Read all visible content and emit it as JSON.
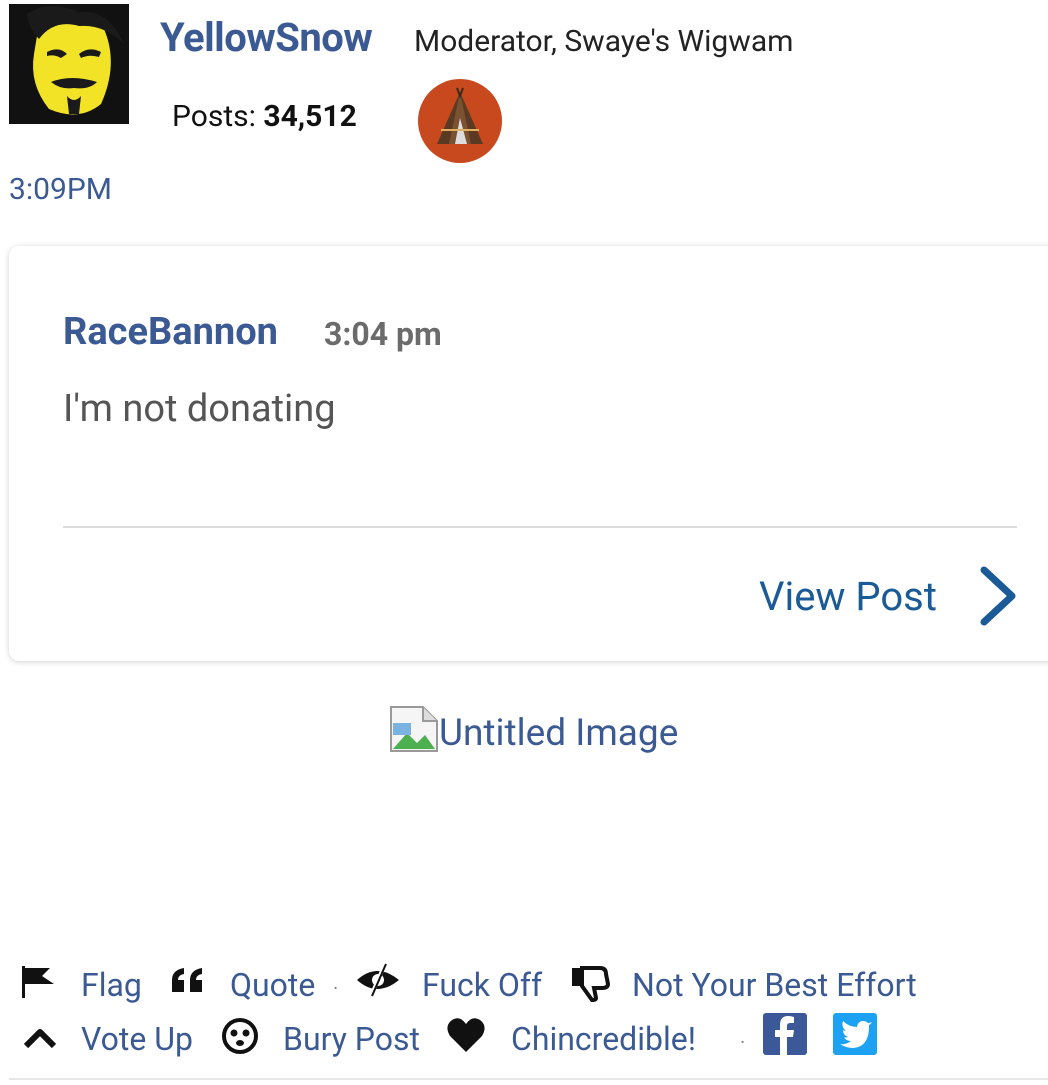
{
  "author": {
    "name": "YellowSnow",
    "role": "Moderator, Swaye's Wigwam",
    "posts_label": "Posts:",
    "posts_count": "34,512",
    "avatar": "user-avatar",
    "badge": "teepee-badge"
  },
  "post_time": "3:09PM",
  "quote": {
    "author": "RaceBannon",
    "time": "3:04 pm",
    "body": "I'm not donating",
    "view_label": "View Post"
  },
  "image": {
    "alt": "Untitled Image"
  },
  "actions": {
    "row1": [
      {
        "label": "Flag",
        "icon": "flag-icon"
      },
      {
        "label": "Quote",
        "icon": "quote-icon"
      },
      {
        "label": "Fuck Off",
        "icon": "hide-icon"
      },
      {
        "label": "Not Your Best Effort",
        "icon": "thumbs-down-icon"
      }
    ],
    "row2": [
      {
        "label": "Vote Up",
        "icon": "chevron-up-icon"
      },
      {
        "label": "Bury Post",
        "icon": "skull-icon"
      },
      {
        "label": "Chincredible!",
        "icon": "heart-icon"
      }
    ],
    "separator": "·",
    "social": [
      "facebook-icon",
      "twitter-icon"
    ]
  },
  "colors": {
    "link": "#3b5a94",
    "view_post": "#1a5a96",
    "facebook": "#3b5998",
    "twitter": "#1da1f2"
  }
}
